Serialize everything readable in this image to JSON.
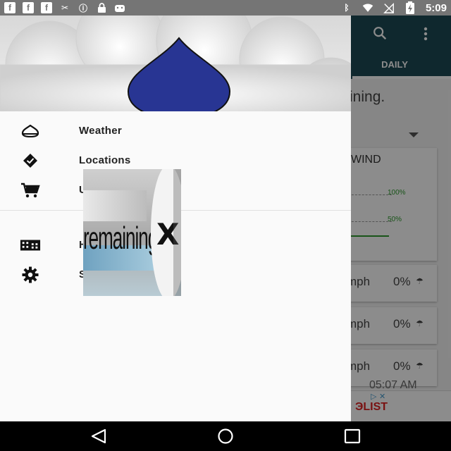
{
  "status_bar": {
    "time": "5:09",
    "left_icons": [
      "facebook-icon",
      "facebook-icon",
      "facebook-icon",
      "satellite-icon",
      "alert-icon",
      "lock-icon",
      "android-icon"
    ],
    "right_icons": [
      "bluetooth-icon",
      "wifi-icon",
      "signal-off-icon",
      "battery-charging-icon"
    ]
  },
  "background_app": {
    "tab_label": "DAILY",
    "partial_text": "ining.",
    "wind_header": "WIND",
    "wind_pct_top": "100%",
    "wind_pct_mid": "50%",
    "rows": [
      {
        "speed": "mph",
        "precip": "0%"
      },
      {
        "speed": "mph",
        "precip": "0%"
      },
      {
        "speed": "mph",
        "precip": "0%"
      }
    ],
    "timestamp": "05:07 AM",
    "ad_text": "ЭLIST"
  },
  "drawer": {
    "items": [
      {
        "label": "Weather",
        "icon": "drop-icon"
      },
      {
        "label": "Locations",
        "icon": "location-check-icon"
      },
      {
        "label": "U",
        "icon": "cart-icon"
      },
      {
        "label": "H",
        "icon": "building-icon"
      },
      {
        "label": "S",
        "icon": "gear-icon"
      }
    ]
  },
  "popup_ad": {
    "text": "remaining",
    "close_glyph": "X"
  },
  "colors": {
    "drop": "#283593",
    "toolbar": "#1c4a55",
    "accent_green": "#2e9a2e"
  }
}
